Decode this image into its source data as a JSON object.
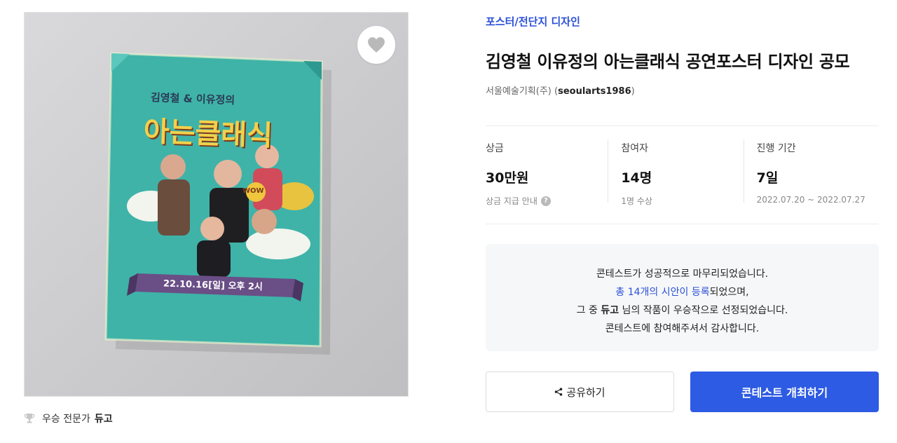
{
  "poster": {
    "image_alt": "아는클래식 공연 포스터",
    "top_line": "김영철 & 이유정의",
    "main_title": "아는클래식",
    "date_line": "22.10.16[일] 오후 2시",
    "wow_badge": "WOW",
    "bg_color": "#3fb3a8"
  },
  "like_button": {
    "icon": "heart-icon"
  },
  "winner": {
    "icon": "trophy-icon",
    "prefix": "우승 전문가",
    "name": "듀고"
  },
  "category": "포스터/전단지 디자인",
  "title": "김영철 이유정의 아는클래식 공연포스터 디자인 공모",
  "host": {
    "company": "서울예술기획(주)",
    "open": "(",
    "user_id": "seoularts1986",
    "close": ")"
  },
  "stats": {
    "prize": {
      "label": "상금",
      "value": "30만원",
      "sub": "상금 지급 안내",
      "help_icon": "question-icon"
    },
    "participants": {
      "label": "참여자",
      "value": "14명",
      "sub": "1명 수상"
    },
    "period": {
      "label": "진행 기간",
      "value": "7일",
      "sub": "2022.07.20 ~ 2022.07.27"
    }
  },
  "notice": {
    "line1": "콘테스트가 성공적으로 마무리되었습니다.",
    "line2_link": "총 14개의 시안이 등록",
    "line2_rest": "되었으며,",
    "line3_pre": "그 중 ",
    "line3_name": "듀고",
    "line3_post": " 님의 작품이 우승작으로 선정되었습니다.",
    "line4": "콘테스트에 참여해주셔서 감사합니다."
  },
  "buttons": {
    "share": "공유하기",
    "share_icon": "share-icon",
    "host_contest": "콘테스트 개최하기"
  },
  "colors": {
    "accent": "#2b50d6",
    "primary_button": "#2d5be3",
    "notice_bg": "#f6f7f9"
  }
}
